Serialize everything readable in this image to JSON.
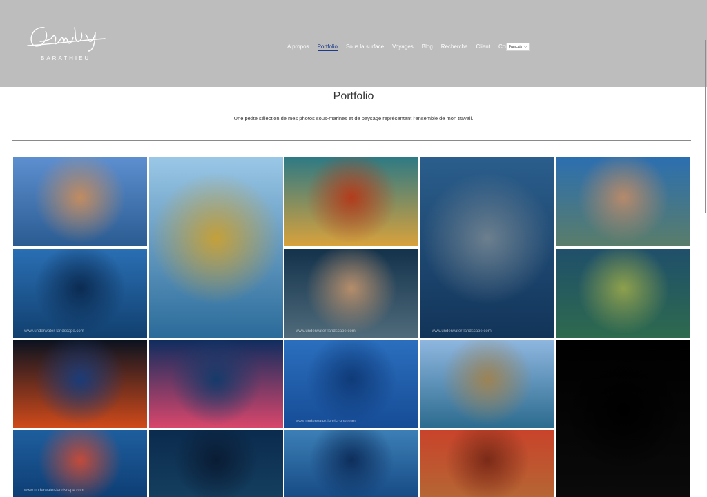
{
  "logo": {
    "script": "Gaby",
    "subtitle": "BARATHIEU"
  },
  "nav": {
    "items": [
      {
        "label": "A propos"
      },
      {
        "label": "Portfolio"
      },
      {
        "label": "Sous la surface"
      },
      {
        "label": "Voyages"
      },
      {
        "label": "Blog"
      },
      {
        "label": "Recherche"
      },
      {
        "label": "Client"
      },
      {
        "label": "Contact"
      }
    ],
    "active": "Portfolio",
    "language": "Français"
  },
  "page": {
    "title": "Portfolio",
    "subtitle": "Une petite sélection de mes photos sous-marines et de paysage représentant l'ensemble de mon travail."
  },
  "watermark": "www.underwater-landscape.com",
  "gallery": [
    {
      "name": "split-reef-shot",
      "colors": [
        "#5d8fd0",
        "#2a5b91",
        "#c18c61"
      ]
    },
    {
      "name": "golden-jellyfish",
      "colors": [
        "#9ac7e6",
        "#2b6b9a",
        "#c4a03a"
      ]
    },
    {
      "name": "eye-closeup",
      "colors": [
        "#2e7a84",
        "#d9a23b",
        "#b23c1c"
      ]
    },
    {
      "name": "humpback-whale",
      "colors": [
        "#2b5e8c",
        "#123459",
        "#6c7f8e"
      ]
    },
    {
      "name": "reef-surface",
      "colors": [
        "#2c6fb0",
        "#5a7d6a",
        "#b58a6b"
      ]
    },
    {
      "name": "manta-ray",
      "colors": [
        "#2a6fb4",
        "#11406f",
        "#0b2b52"
      ]
    },
    {
      "name": "coral-reflection",
      "colors": [
        "#13324b",
        "#4f6b7b",
        "#b58e6b"
      ]
    },
    {
      "name": "mangrove",
      "colors": [
        "#1f4f6b",
        "#2e6a4e",
        "#8ea04c"
      ]
    },
    {
      "name": "blue-eye-pattern",
      "colors": [
        "#0a1220",
        "#d04a1a",
        "#1b3c78"
      ]
    },
    {
      "name": "red-coral",
      "colors": [
        "#0e2d5f",
        "#d9466b",
        "#153a6a"
      ]
    },
    {
      "name": "dolphins",
      "colors": [
        "#2b6fbe",
        "#164c96",
        "#0f3a78"
      ]
    },
    {
      "name": "split-reef-fish",
      "colors": [
        "#8fb7e0",
        "#2c6b8e",
        "#9c8355"
      ]
    },
    {
      "name": "ghost-pipefish",
      "colors": [
        "#000000",
        "#0a0a0a",
        "#000000"
      ]
    },
    {
      "name": "fish-ball-coral",
      "colors": [
        "#1e5e9e",
        "#0e3e74",
        "#c24b3a"
      ]
    },
    {
      "name": "divers-night",
      "colors": [
        "#0b2b4e",
        "#143e5e",
        "#0a1c34"
      ]
    },
    {
      "name": "sardine-school",
      "colors": [
        "#3c7fb6",
        "#174b86",
        "#0d2e5c"
      ]
    },
    {
      "name": "scorpionfish",
      "colors": [
        "#c9432b",
        "#b56634",
        "#7a2a18"
      ]
    }
  ]
}
